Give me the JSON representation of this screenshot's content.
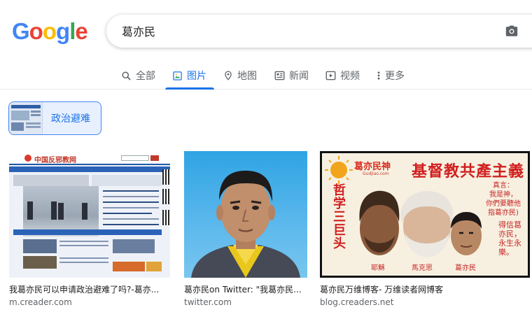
{
  "logo": [
    "G",
    "o",
    "o",
    "g",
    "l",
    "e"
  ],
  "logo_colors": [
    "#4285f4",
    "#ea4335",
    "#fbbc05",
    "#4285f4",
    "#34a853",
    "#ea4335"
  ],
  "search": {
    "query": "葛亦民"
  },
  "tabs": [
    {
      "label": "全部",
      "icon": "search-icon"
    },
    {
      "label": "图片",
      "icon": "image-icon"
    },
    {
      "label": "地图",
      "icon": "map-pin-icon"
    },
    {
      "label": "新闻",
      "icon": "news-icon"
    },
    {
      "label": "视频",
      "icon": "video-icon"
    },
    {
      "label": "更多",
      "icon": "more-dots-icon"
    }
  ],
  "active_tab": "图片",
  "chip": {
    "label": "政治避难"
  },
  "results": [
    {
      "title": "我葛亦民可以申请政治避难了吗?-葛亦...",
      "source": "m.creader.com",
      "site_header": "中国反邪教网"
    },
    {
      "title": "葛亦民on Twitter: \"我葛亦民...",
      "source": "twitter.com"
    },
    {
      "title": "葛亦民万维博客- 万维读者网博客",
      "source": "blog.creaders.net",
      "poster": {
        "logo_text": "葛亦民神",
        "banner": "基督教共產主義",
        "left_vertical": "哲学三巨头",
        "quote_title": "真言：",
        "quote_lines": [
          "我是神，",
          "你們要聽他",
          "指葛亦民)"
        ],
        "right_vertical": "得信葛亦民，永生永樂。",
        "captions": [
          "耶穌",
          "馬克思",
          "葛亦民"
        ],
        "site": "Gudjiao.com"
      }
    }
  ]
}
